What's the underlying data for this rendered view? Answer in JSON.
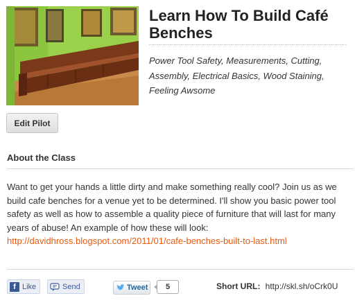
{
  "course": {
    "title": "Learn How To Build Café Benches",
    "topics": "Power Tool Safety, Measurements, Cutting, Assembly, Electrical Basics, Wood Staining, Feeling Awsome",
    "photo_alt": "Wooden café bench photo"
  },
  "actions": {
    "edit_label": "Edit Pilot"
  },
  "about": {
    "heading": "About the Class",
    "body": "Want to get your hands a little dirty and make something really cool? Join us as we build cafe benches for a venue yet to be determined. I'll show you basic power tool safety as well as how to assemble a quality piece of furniture that will last for many years of abuse! An example of how these will look:",
    "link": "http://davidhross.blogspot.com/2011/01/cafe-benches-built-to-last.html"
  },
  "share": {
    "like_label": "Like",
    "send_label": "Send",
    "tweet_label": "Tweet",
    "tweet_count": "5",
    "short_url_label": "Short URL:",
    "short_url_value": "http://skl.sh/oCrk0U"
  },
  "colors": {
    "link": "#e8590f",
    "facebook": "#3b5998",
    "wall": "#8bc53f"
  }
}
